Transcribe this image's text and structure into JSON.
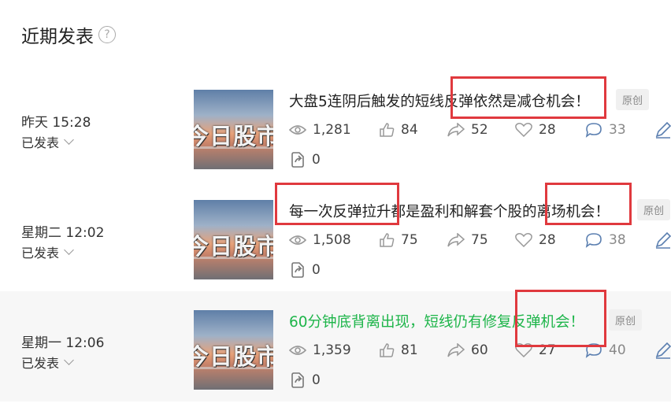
{
  "header": {
    "title": "近期发表",
    "help_icon": "question-circle-icon"
  },
  "colors": {
    "highlight": "#e0393e",
    "active_title": "#1eb54a",
    "active_row_bg": "#f7f7f7"
  },
  "posts": [
    {
      "date": "昨天 15:28",
      "status": "已发表",
      "thumb_text": "今日股市",
      "title": "大盘5连阴后触发的短线反弹依然是减仓机会！",
      "badge": "原创",
      "views": "1,281",
      "likes": "84",
      "shares": "52",
      "favorites": "28",
      "comments": "33",
      "edits": "0"
    },
    {
      "date": "星期二 12:02",
      "status": "已发表",
      "thumb_text": "今日股市",
      "title": "每一次反弹拉升都是盈利和解套个股的离场机会！",
      "badge": "原创",
      "views": "1,508",
      "likes": "75",
      "shares": "75",
      "favorites": "28",
      "comments": "38",
      "edits": "0"
    },
    {
      "date": "星期一 12:06",
      "status": "已发表",
      "thumb_text": "今日股市",
      "title": "60分钟底背离出现，短线仍有修复反弹机会！",
      "badge": "原创",
      "views": "1,359",
      "likes": "81",
      "shares": "60",
      "favorites": "27",
      "comments": "40",
      "edits": "0"
    }
  ]
}
